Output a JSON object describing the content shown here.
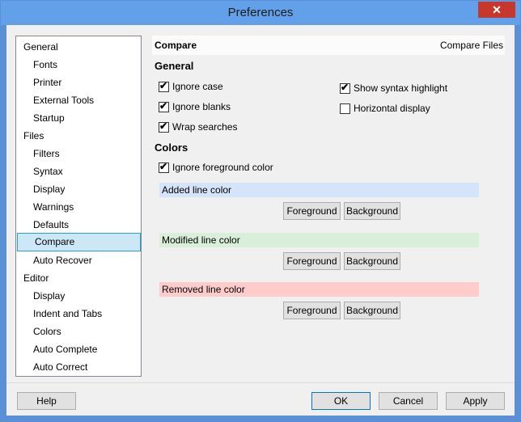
{
  "window": {
    "title": "Preferences",
    "close_glyph": "✕"
  },
  "sidebar": {
    "items": [
      {
        "label": "General",
        "level": 0
      },
      {
        "label": "Fonts",
        "level": 1
      },
      {
        "label": "Printer",
        "level": 1
      },
      {
        "label": "External Tools",
        "level": 1
      },
      {
        "label": "Startup",
        "level": 1
      },
      {
        "label": "Files",
        "level": 0
      },
      {
        "label": "Filters",
        "level": 1
      },
      {
        "label": "Syntax",
        "level": 1
      },
      {
        "label": "Display",
        "level": 1
      },
      {
        "label": "Warnings",
        "level": 1
      },
      {
        "label": "Defaults",
        "level": 1
      },
      {
        "label": "Compare",
        "level": 1,
        "selected": true
      },
      {
        "label": "Auto Recover",
        "level": 1
      },
      {
        "label": "Editor",
        "level": 0
      },
      {
        "label": "Display",
        "level": 1
      },
      {
        "label": "Indent and Tabs",
        "level": 1
      },
      {
        "label": "Colors",
        "level": 1
      },
      {
        "label": "Auto Complete",
        "level": 1
      },
      {
        "label": "Auto Correct",
        "level": 1
      }
    ]
  },
  "main": {
    "header_title": "Compare",
    "header_subtitle": "Compare Files",
    "general_section": "General",
    "checkboxes": {
      "ignore_case": {
        "label": "Ignore case",
        "checked": true
      },
      "ignore_blanks": {
        "label": "Ignore blanks",
        "checked": true
      },
      "wrap_searches": {
        "label": "Wrap searches",
        "checked": true
      },
      "show_syntax": {
        "label": "Show syntax highlight",
        "checked": true
      },
      "horizontal": {
        "label": "Horizontal display",
        "checked": false
      },
      "ignore_fg": {
        "label": "Ignore foreground color",
        "checked": true
      }
    },
    "colors_section": "Colors",
    "bands": {
      "added": {
        "label": "Added line color",
        "color": "#d6e4fa"
      },
      "modified": {
        "label": "Modified line color",
        "color": "#d9efd9"
      },
      "removed": {
        "label": "Removed line color",
        "color": "#ffcccc"
      }
    },
    "fg_label": "Foreground",
    "bg_label": "Background",
    "check_glyph": "✔"
  },
  "footer": {
    "help": "Help",
    "ok": "OK",
    "cancel": "Cancel",
    "apply": "Apply"
  }
}
